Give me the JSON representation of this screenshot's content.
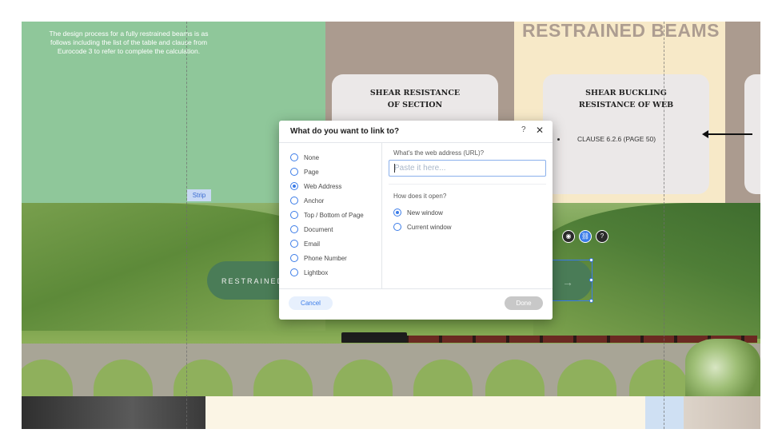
{
  "canvas": {
    "intro_text": "The design process for a fully restrained beams is as follows including the list of the table and clause from Eurocode 3 to refer to complete the calculation.",
    "heading": "RESTRAINED BEAMS",
    "card_1_title_line1": "SHEAR RESISTANCE",
    "card_1_title_line2": "OF SECTION",
    "card_2_title_line1": "SHEAR BUCKLING",
    "card_2_title_line2": "RESISTANCE OF WEB",
    "card_2_bullet": "CLAUSE 6.2.6 (PAGE 50)",
    "strip_label": "Strip",
    "button_text": "RESTRAINED"
  },
  "dialog": {
    "title": "What do you want to link to?",
    "help_glyph": "?",
    "close_glyph": "✕",
    "options": [
      {
        "label": "None",
        "checked": false
      },
      {
        "label": "Page",
        "checked": false
      },
      {
        "label": "Web Address",
        "checked": true
      },
      {
        "label": "Anchor",
        "checked": false
      },
      {
        "label": "Top / Bottom of Page",
        "checked": false
      },
      {
        "label": "Document",
        "checked": false
      },
      {
        "label": "Email",
        "checked": false
      },
      {
        "label": "Phone Number",
        "checked": false
      },
      {
        "label": "Lightbox",
        "checked": false
      }
    ],
    "url_label": "What's the web address (URL)?",
    "url_placeholder": "Paste it here...",
    "url_value": "",
    "open_label": "How does it open?",
    "open_options": [
      {
        "label": "New window",
        "checked": true
      },
      {
        "label": "Current window",
        "checked": false
      }
    ],
    "cancel_label": "Cancel",
    "done_label": "Done"
  },
  "colors": {
    "accent": "#3b7ce8",
    "green_panel": "#8fc79a",
    "taupe_panel": "#ab9b8f",
    "cream_panel": "#f7e9c8",
    "button_green": "#4a7c57"
  }
}
